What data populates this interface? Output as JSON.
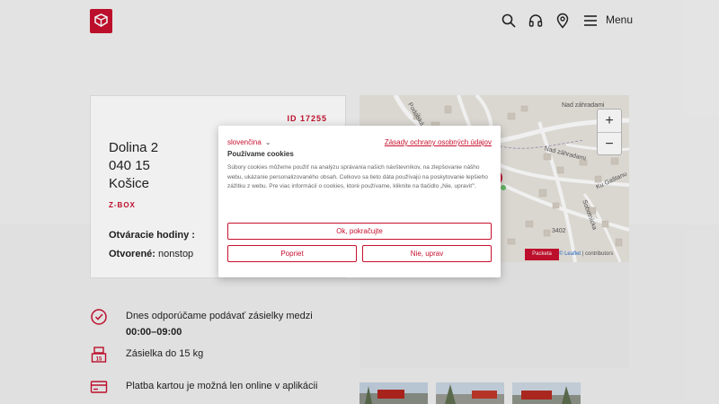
{
  "header": {
    "logo_icon": "packeta-logo-icon",
    "icons": [
      "search-icon",
      "headset-icon",
      "location-pin-icon",
      "hamburger-icon"
    ],
    "menu_label": "Menu"
  },
  "card": {
    "id_label": "ID 17255",
    "address_line1": "Dolina 2",
    "address_line2": "040 15",
    "address_line3": "Košice",
    "type_label": "Z-BOX",
    "hours_label": "Otváracie hodiny :",
    "open_label": "Otvorené:",
    "open_value": "nonstop"
  },
  "map": {
    "zoom_in": "+",
    "zoom_out": "−",
    "street_1": "Nad záhradami",
    "street_2": "Nad záhradami",
    "street_3": "Podolská",
    "street_4": "Ku Gaštanu",
    "street_5": "Sobotnícka",
    "house_number": "3402",
    "badge": "Packeta",
    "attribution_link": "© Leaflet",
    "attribution_rest": "| contributors"
  },
  "features": [
    {
      "icon": "clock-icon",
      "text_prefix": "Dnes odporúčame podávať zásielky medzi",
      "text_bold": "00:00–09:00"
    },
    {
      "icon": "weight-icon",
      "text": "Zásielka do 15 kg"
    },
    {
      "icon": "card-icon",
      "text": "Platba kartou je možná len online v aplikácii"
    }
  ],
  "cookie": {
    "language": "slovenčina",
    "policy_link": "Zásady ochrany osobných údajov",
    "title": "Používame cookies",
    "text": "Súbory cookies môžeme použiť na analýzu správania našich návštevníkov, na zlepšovanie nášho webu, ukázanie personalizovaného obsah. Celkovo sa tieto dáta používajú na poskytovanie lepšieho zážitku z webu. Pre viac informácií o cookies, ktoré používame, kliknite na tlačidlo „Nie, upraviť\".",
    "ok_button": "Ok, pokračujte",
    "reject_button": "Popriet",
    "adjust_button": "Nie, uprav"
  },
  "colors": {
    "brand": "#c8102e",
    "background": "#f2f2f2"
  }
}
